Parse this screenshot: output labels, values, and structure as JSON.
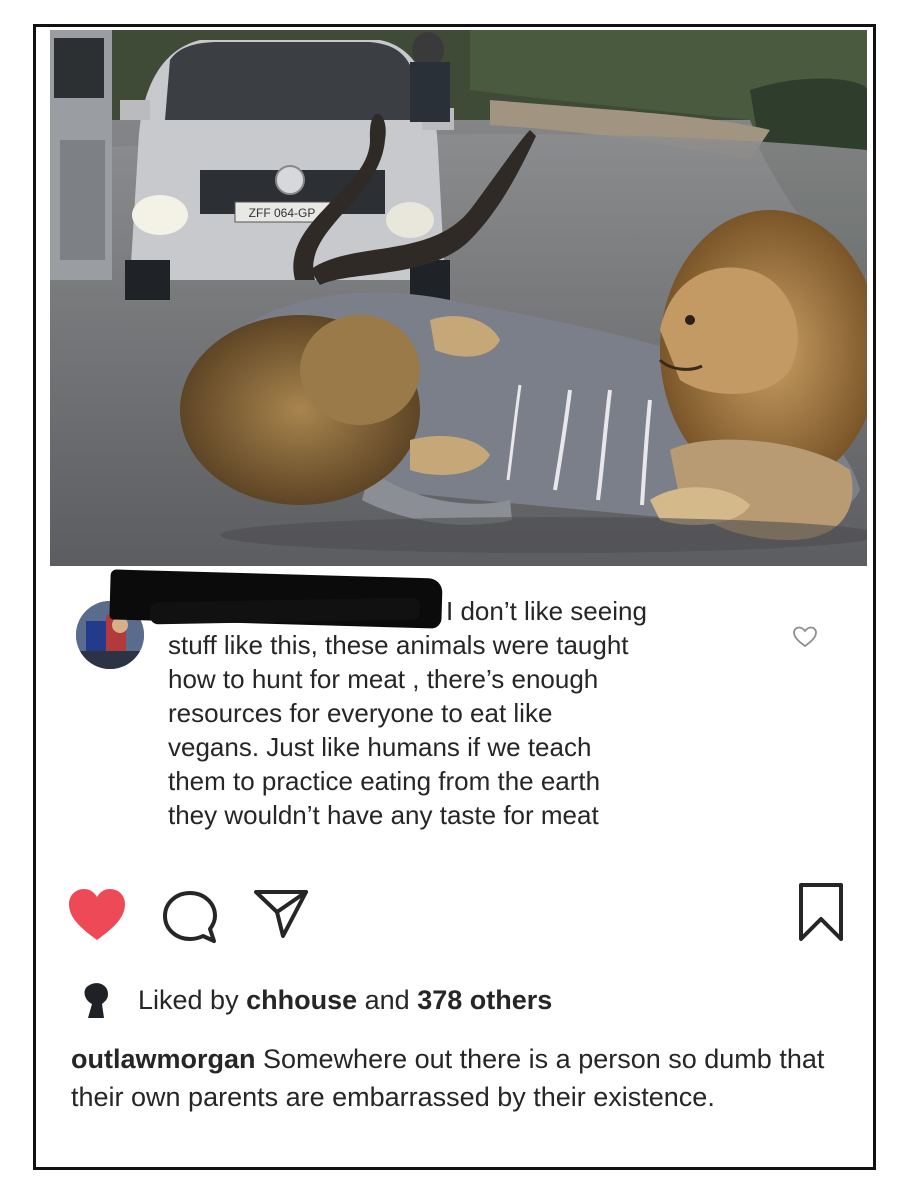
{
  "post": {
    "photo": {
      "license_plate": "ZFF 064-GP"
    },
    "comment": {
      "lines": [
        "I don’t like seeing",
        "stuff like this, these animals were taught",
        "how to hunt for meat , there’s enough",
        "resources for everyone to eat like",
        "vegans. Just like humans if we teach",
        "them to practice eating from the earth",
        "they wouldn’t have any taste for meat"
      ]
    },
    "actions": {
      "like_icon": "heart-filled-icon",
      "comment_icon": "speech-bubble-icon",
      "share_icon": "paper-plane-icon",
      "save_icon": "bookmark-icon",
      "like_color": "#ed4956"
    },
    "likes": {
      "prefix": "Liked by",
      "user": "chhouse",
      "joiner": "and",
      "others": "378 others"
    },
    "caption": {
      "username": "outlawmorgan",
      "text": "Somewhere out there is a person so dumb that their own parents are embarrassed by their existence."
    }
  }
}
